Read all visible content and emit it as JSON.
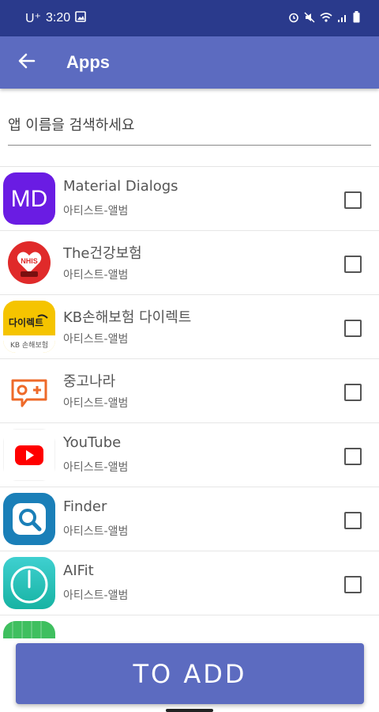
{
  "status_bar": {
    "carrier": "U⁺",
    "time": "3:20",
    "bg_color": "#2a3a8c"
  },
  "app_bar": {
    "title": "Apps",
    "color": "#5c6bc0",
    "back_icon": "arrow-back-icon"
  },
  "search": {
    "placeholder": "앱 이름을 검색하세요",
    "value": ""
  },
  "apps": [
    {
      "name": "Material Dialogs",
      "subtitle": "아티스트-앨범",
      "icon": "md-icon",
      "checked": false
    },
    {
      "name": "The건강보험",
      "subtitle": "아티스트-앨범",
      "icon": "nhis-icon",
      "checked": false
    },
    {
      "name": "KB손해보험 다이렉트",
      "subtitle": "아티스트-앨범",
      "icon": "kb-icon",
      "checked": false,
      "icon_text_top": "다이렉트",
      "icon_text_bottom": "KB 손해보험"
    },
    {
      "name": "중고나라",
      "subtitle": "아티스트-앨범",
      "icon": "joonggonara-icon",
      "checked": false
    },
    {
      "name": "YouTube",
      "subtitle": "아티스트-앨범",
      "icon": "youtube-icon",
      "checked": false
    },
    {
      "name": "Finder",
      "subtitle": "아티스트-앨범",
      "icon": "finder-icon",
      "checked": false
    },
    {
      "name": "AIFit",
      "subtitle": "아티스트-앨범",
      "icon": "aifit-icon",
      "checked": false
    }
  ],
  "add_button": {
    "label": "TO ADD",
    "color": "#5c6bc0"
  }
}
